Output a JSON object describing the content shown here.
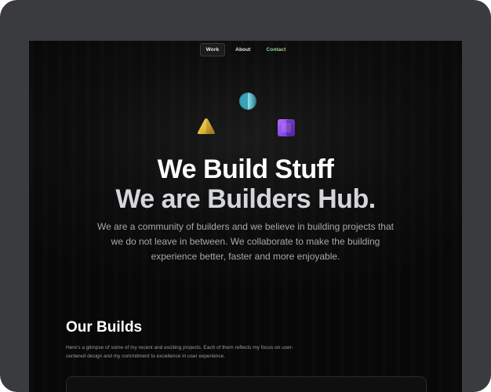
{
  "nav": {
    "items": [
      {
        "label": "Work",
        "active": true
      },
      {
        "label": "About",
        "active": false
      },
      {
        "label": "Contact",
        "active": false
      }
    ]
  },
  "hero": {
    "title": "We Build Stuff",
    "subtitle": "We are Builders Hub.",
    "description": "We are a community of builders and we believe in building projects that we do not leave in between. We collaborate to make the building experience better, faster and more enjoyable."
  },
  "icons": {
    "circle": "circle-shape-icon",
    "triangle": "triangle-shape-icon",
    "square": "square-shape-icon"
  },
  "builds": {
    "title": "Our Builds",
    "description": "Here's a glimpse of some of my recent and exciting projects. Each of them reflects my focus on user-centered design and my commitment to excellence in user experience."
  },
  "colors": {
    "frame": "#3a3b3e",
    "background": "#0d0d0d",
    "title": "#ffffff",
    "subtitle": "#d4d6db",
    "body_text": "#a8a8a8"
  }
}
